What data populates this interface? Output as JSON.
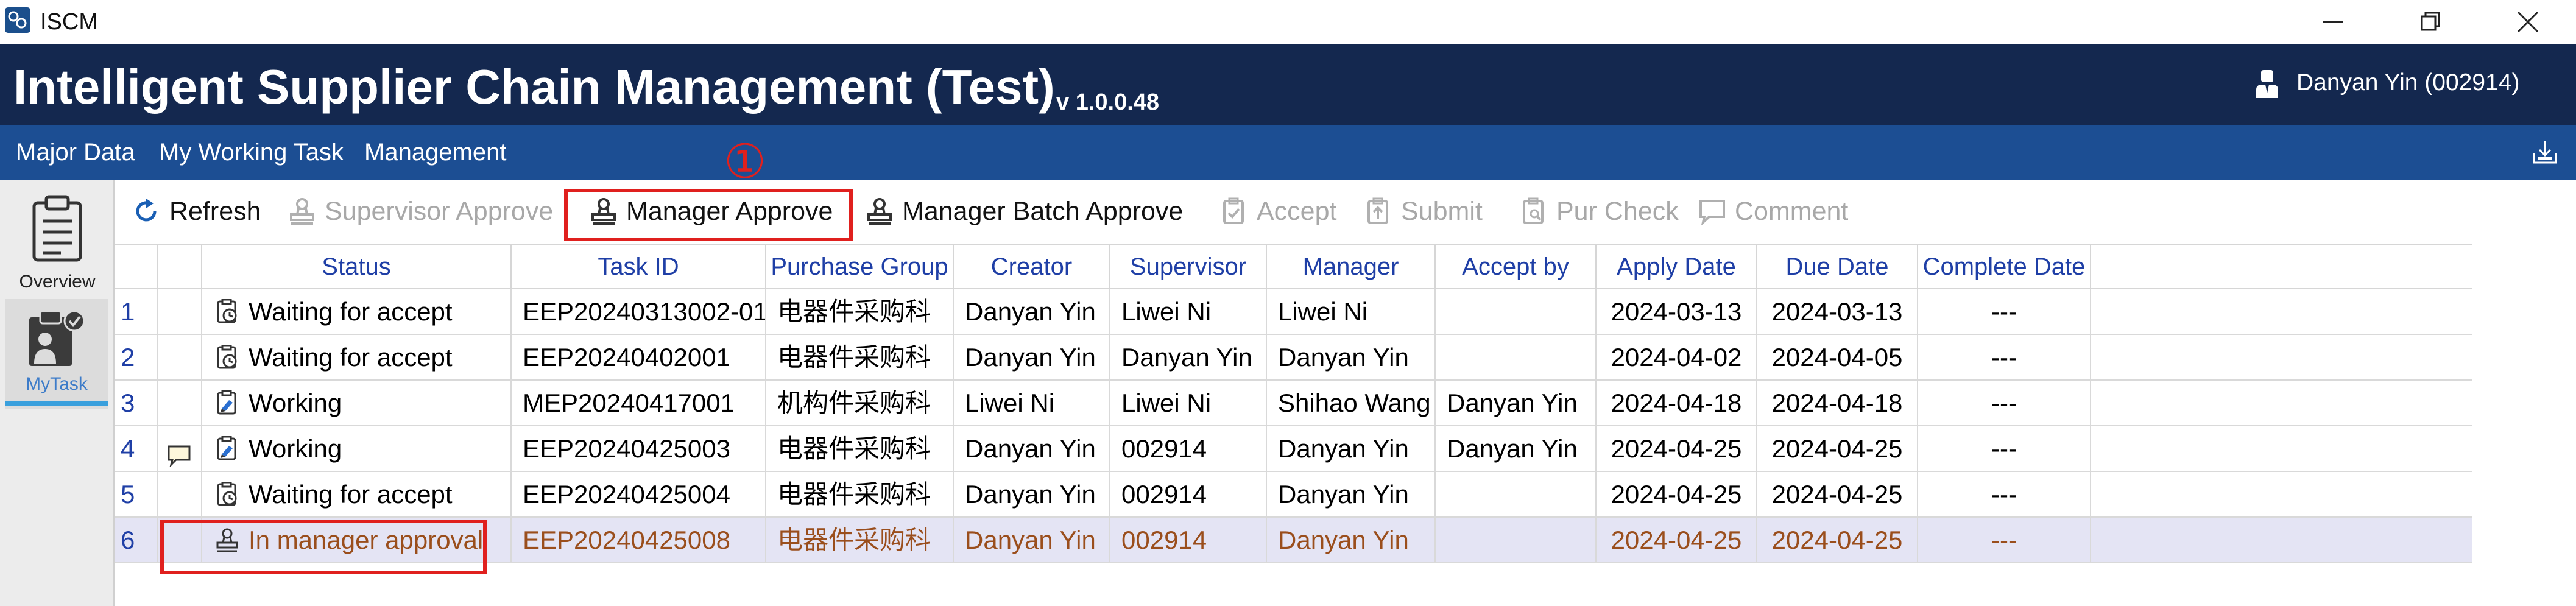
{
  "window": {
    "app_name": "ISCM"
  },
  "header": {
    "title": "Intelligent Supplier Chain Management (Test)",
    "version": "v 1.0.0.48",
    "user": "Danyan Yin (002914)"
  },
  "menu": {
    "items": [
      "Major Data",
      "My Working Task",
      "Management"
    ]
  },
  "sidenav": {
    "overview_label": "Overview",
    "mytask_label": "MyTask",
    "active": "MyTask"
  },
  "toolbar": {
    "refresh": "Refresh",
    "supervisor_approve": "Supervisor Approve",
    "manager_approve": "Manager Approve",
    "manager_batch_approve": "Manager Batch Approve",
    "accept": "Accept",
    "submit": "Submit",
    "pur_check": "Pur Check",
    "comment": "Comment"
  },
  "annotation": {
    "step_marker": "①",
    "highlight_color": "#e0201e"
  },
  "grid": {
    "columns": [
      "Status",
      "Task ID",
      "Purchase Group",
      "Creator",
      "Supervisor",
      "Manager",
      "Accept by",
      "Apply Date",
      "Due Date",
      "Complete Date"
    ],
    "rows": [
      {
        "num": "1",
        "has_comment": false,
        "status_icon": "clock-icon",
        "status": "Waiting for accept",
        "task_id": "EEP20240313002-01",
        "purchase_group": "电器件采购科",
        "creator": "Danyan Yin",
        "supervisor": "Liwei Ni",
        "manager": "Liwei Ni",
        "accept_by": "",
        "apply_date": "2024-03-13",
        "due_date": "2024-03-13",
        "complete_date": "---"
      },
      {
        "num": "2",
        "has_comment": false,
        "status_icon": "clock-icon",
        "status": "Waiting for accept",
        "task_id": "EEP20240402001",
        "purchase_group": "电器件采购科",
        "creator": "Danyan Yin",
        "supervisor": "Danyan Yin",
        "manager": "Danyan Yin",
        "accept_by": "",
        "apply_date": "2024-04-02",
        "due_date": "2024-04-05",
        "complete_date": "---"
      },
      {
        "num": "3",
        "has_comment": false,
        "status_icon": "working-icon",
        "status": "Working",
        "task_id": "MEP20240417001",
        "purchase_group": "机构件采购科",
        "creator": "Liwei Ni",
        "supervisor": "Liwei Ni",
        "manager": "Shihao Wang",
        "accept_by": "Danyan Yin",
        "apply_date": "2024-04-18",
        "due_date": "2024-04-18",
        "complete_date": "---"
      },
      {
        "num": "4",
        "has_comment": true,
        "status_icon": "working-icon",
        "status": "Working",
        "task_id": "EEP20240425003",
        "purchase_group": "电器件采购科",
        "creator": "Danyan Yin",
        "supervisor": "002914",
        "manager": "Danyan Yin",
        "accept_by": "Danyan Yin",
        "apply_date": "2024-04-25",
        "due_date": "2024-04-25",
        "complete_date": "---"
      },
      {
        "num": "5",
        "has_comment": false,
        "status_icon": "clock-icon",
        "status": "Waiting for accept",
        "task_id": "EEP20240425004",
        "purchase_group": "电器件采购科",
        "creator": "Danyan Yin",
        "supervisor": "002914",
        "manager": "Danyan Yin",
        "accept_by": "",
        "apply_date": "2024-04-25",
        "due_date": "2024-04-25",
        "complete_date": "---"
      },
      {
        "num": "6",
        "has_comment": false,
        "status_icon": "stamp-icon",
        "status": "In manager approval",
        "task_id": "EEP20240425008",
        "purchase_group": "电器件采购科",
        "creator": "Danyan Yin",
        "supervisor": "002914",
        "manager": "Danyan Yin",
        "accept_by": "",
        "apply_date": "2024-04-25",
        "due_date": "2024-04-25",
        "complete_date": "---",
        "selected": true
      }
    ]
  },
  "colors": {
    "header_bg": "#14284f",
    "menu_bg": "#1c4e93",
    "column_header_text": "#1f3fa6",
    "selected_row_bg": "#e4e4f4",
    "selected_row_text": "#9a4e1c",
    "disabled_text": "#a8a8a8"
  }
}
